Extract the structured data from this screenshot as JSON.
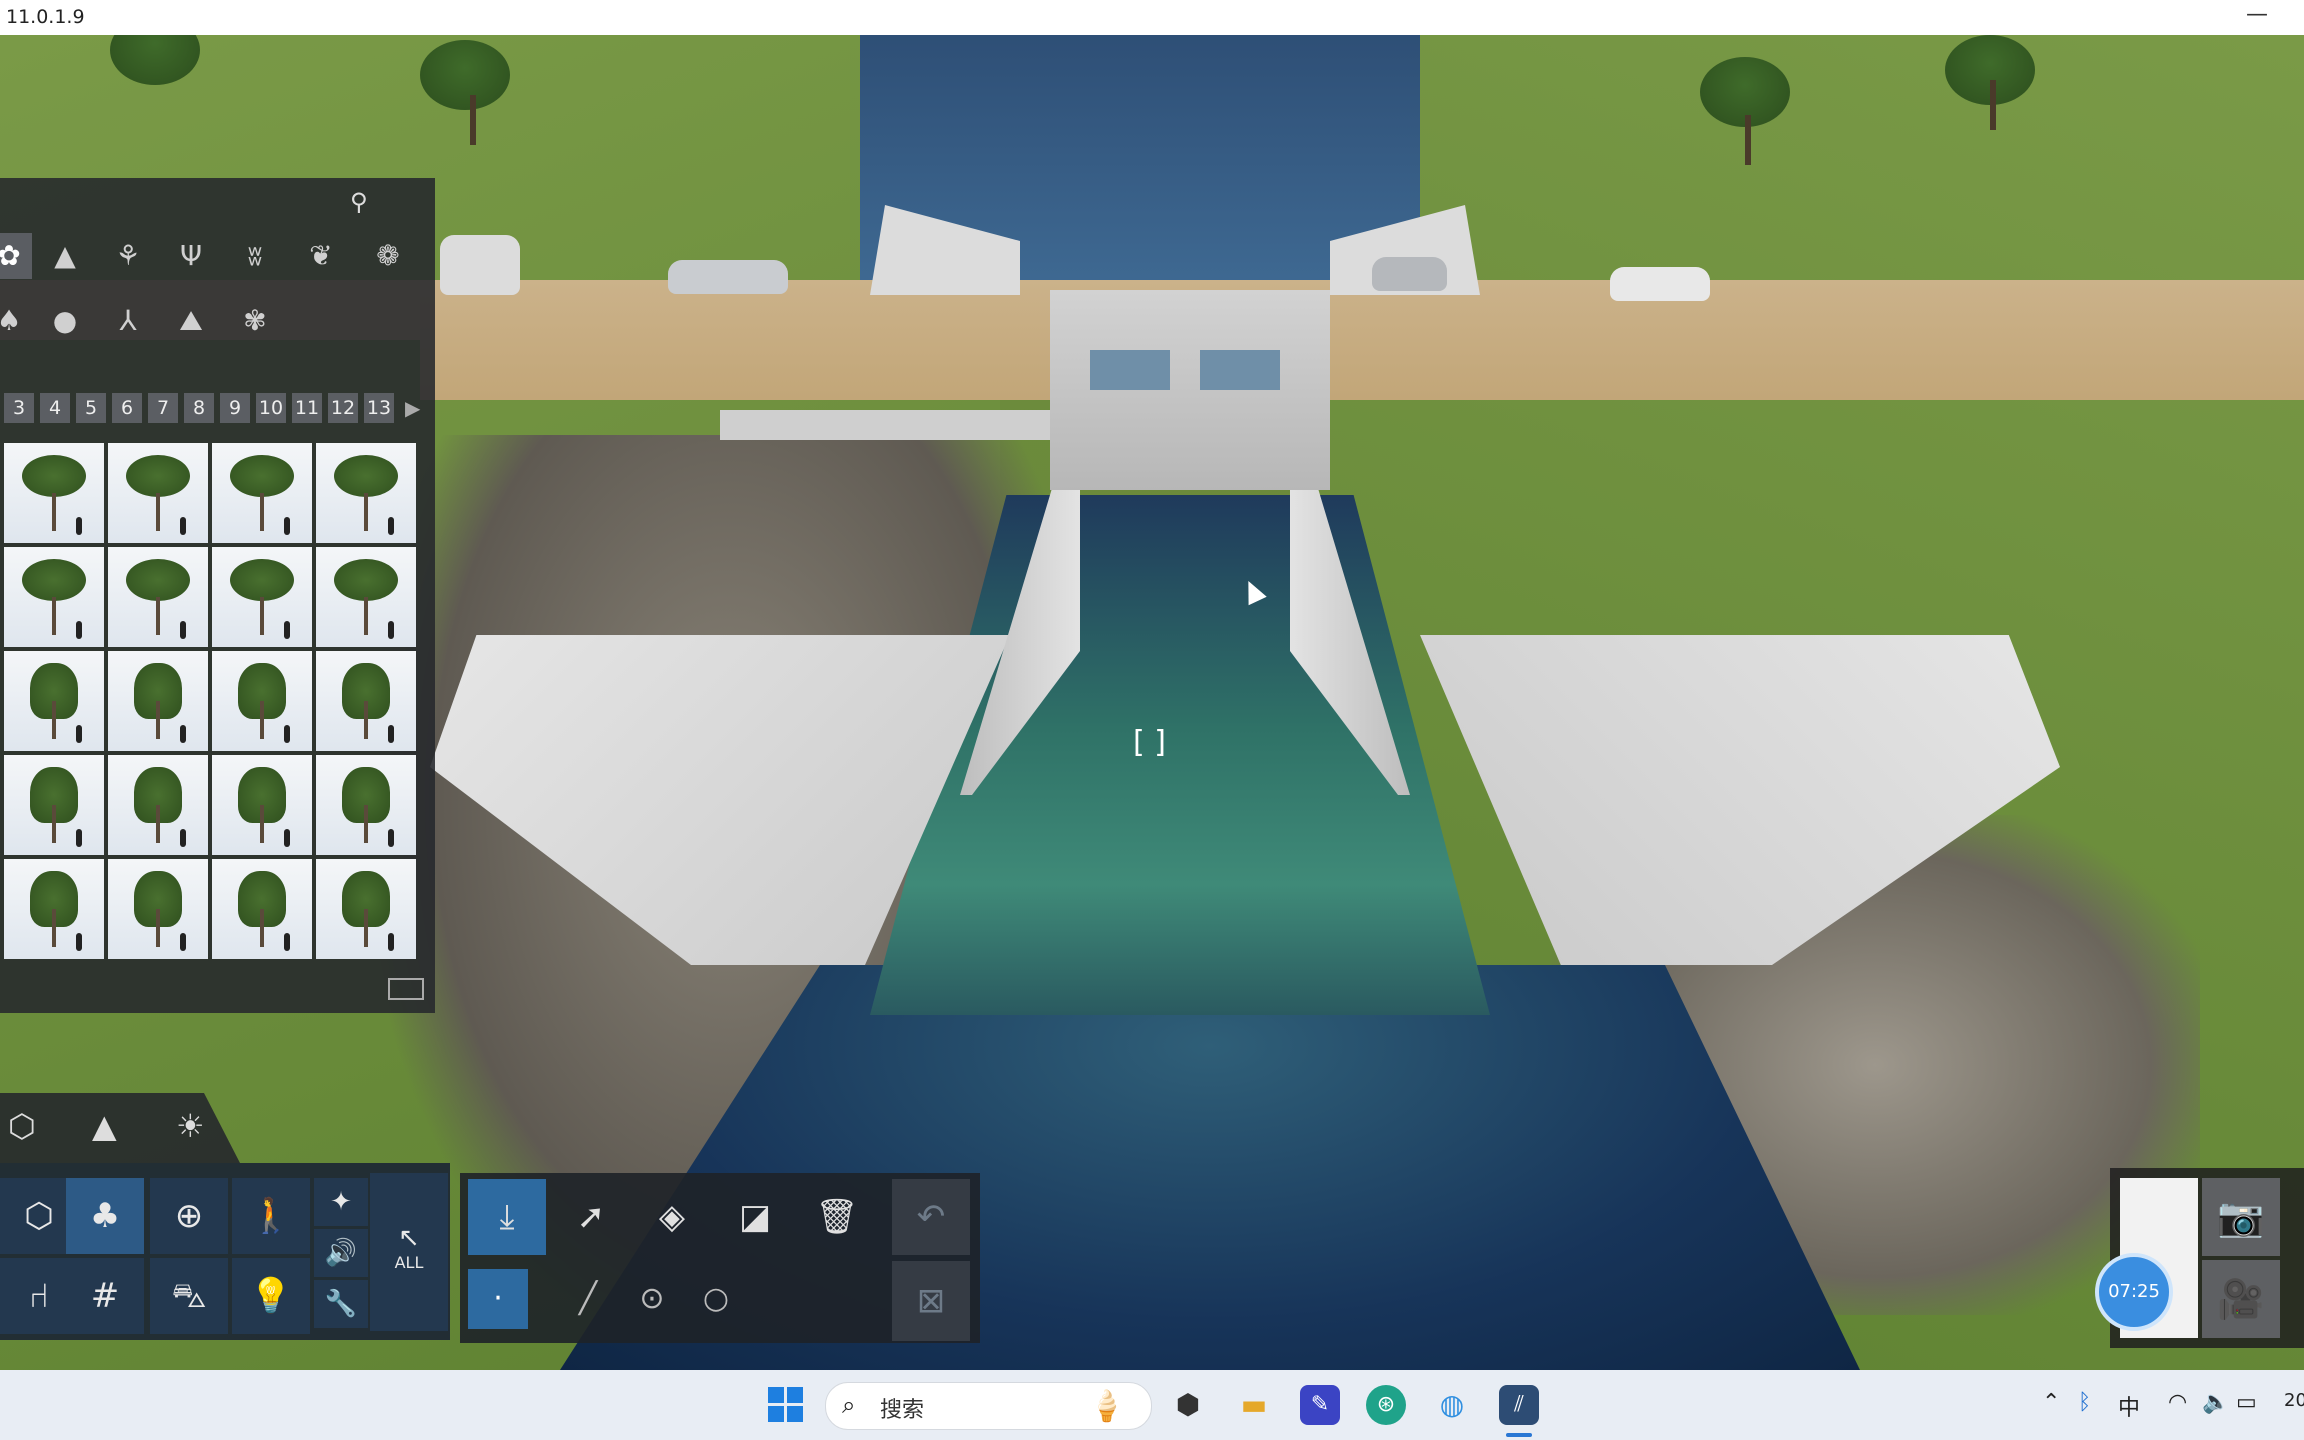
{
  "window": {
    "version": "11.0.1.9",
    "minimize_glyph": "—"
  },
  "viewport": {
    "cursor_icon": "arrow-cursor",
    "focus_indicator": "[ ]"
  },
  "library": {
    "search_icon": "search-icon",
    "categories_row1": [
      "flower-icon",
      "conifer-icon",
      "palm-icon",
      "bare-tree-icon",
      "grass-icon",
      "leaf-plant-icon",
      "flower-bloom-icon"
    ],
    "categories_row2": [
      "small-tree-icon",
      "leaf-drop-icon",
      "branch-icon",
      "mountain-icon",
      "fern-icon"
    ],
    "pages": [
      "3",
      "4",
      "5",
      "6",
      "7",
      "8",
      "9",
      "10",
      "11",
      "12",
      "13"
    ],
    "next_page_glyph": "▶",
    "thumbnail_count": 20
  },
  "mode_tabs": [
    "material-icon",
    "terrain-icon",
    "sun-icon"
  ],
  "object_toolbar": {
    "buttons": [
      "model-icon",
      "tree-icon",
      "tree-add-icon",
      "walking-person-icon",
      "chair-icon",
      "fence-icon",
      "car-icon",
      "light-bulb-icon"
    ],
    "small_buttons": [
      "magic-wand-icon",
      "sound-icon",
      "wrench-icon"
    ],
    "all_label": "ALL"
  },
  "edit_toolbar": {
    "buttons": [
      "place-icon",
      "select-arrow-icon",
      "rotate-icon",
      "scale-icon",
      "delete-icon",
      "undo-icon"
    ],
    "sub_buttons": [
      "single-dot-icon",
      "line-icon",
      "point-icon",
      "circle-icon",
      "deselect-icon"
    ]
  },
  "camera_panel": {
    "timer": "07:25",
    "icons": [
      "camera-icon",
      "video-icon"
    ]
  },
  "taskbar": {
    "search_placeholder": "搜索",
    "apps": [
      "cube-app-icon",
      "folder-icon",
      "edit-app-icon",
      "green-app-icon",
      "browser-icon",
      "lumion-icon"
    ],
    "tray": {
      "ime": "中",
      "clock_fragment": "20"
    }
  }
}
